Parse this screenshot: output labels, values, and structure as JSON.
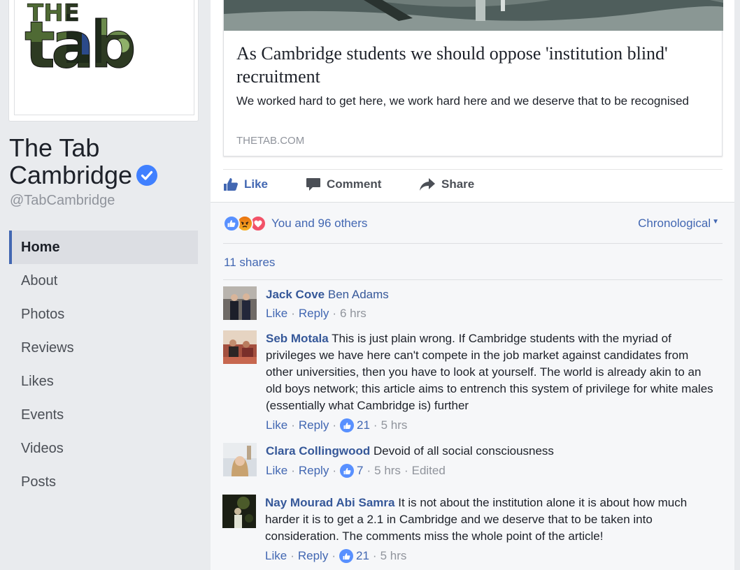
{
  "sidebar": {
    "logo_text": "the tab",
    "page_name": "The Tab Cambridge",
    "handle": "@TabCambridge",
    "nav": [
      {
        "label": "Home",
        "active": true
      },
      {
        "label": "About"
      },
      {
        "label": "Photos"
      },
      {
        "label": "Reviews"
      },
      {
        "label": "Likes"
      },
      {
        "label": "Events"
      },
      {
        "label": "Videos"
      },
      {
        "label": "Posts"
      }
    ]
  },
  "post": {
    "link": {
      "title": "As Cambridge students we should oppose 'institution blind' recruitment",
      "description": "We worked hard to get here, we work hard here and we deserve that to be recognised",
      "domain": "THETAB.COM"
    },
    "actions": {
      "like": "Like",
      "comment": "Comment",
      "share": "Share"
    },
    "reactions_text": "You and 96 others",
    "sort_label": "Chronological",
    "shares_text": "11 shares"
  },
  "comments": [
    {
      "author": "Jack Cove",
      "text_tag": "Ben Adams",
      "text": "",
      "like": "Like",
      "reply": "Reply",
      "likes": "",
      "time": "6 hrs",
      "edited": ""
    },
    {
      "author": "Seb Motala",
      "text": "This is just plain wrong. If Cambridge students with the myriad of privileges we have here can't compete in the job market against candidates from other universities, then you have to look at yourself. The world is already akin to an old boys network; this article aims to entrench this system of privilege for white males (essentially what Cambridge is) further",
      "like": "Like",
      "reply": "Reply",
      "likes": "21",
      "time": "5 hrs",
      "edited": ""
    },
    {
      "author": "Clara Collingwood",
      "text": "Devoid of all social consciousness",
      "like": "Like",
      "reply": "Reply",
      "likes": "7",
      "time": "5 hrs",
      "edited": "Edited"
    },
    {
      "author": "Nay Mourad Abi Samra",
      "text": "It is not about the institution alone it is about how much harder it is to get a 2.1 in Cambridge and we deserve that to be taken into consideration. The comments miss the whole point of the article!",
      "like": "Like",
      "reply": "Reply",
      "likes": "21",
      "time": "5 hrs",
      "edited": ""
    }
  ],
  "colors": {
    "facebook_blue": "#4267b2",
    "link_blue": "#365899",
    "muted_gray": "#90949c",
    "page_bg": "#e9ebee"
  }
}
